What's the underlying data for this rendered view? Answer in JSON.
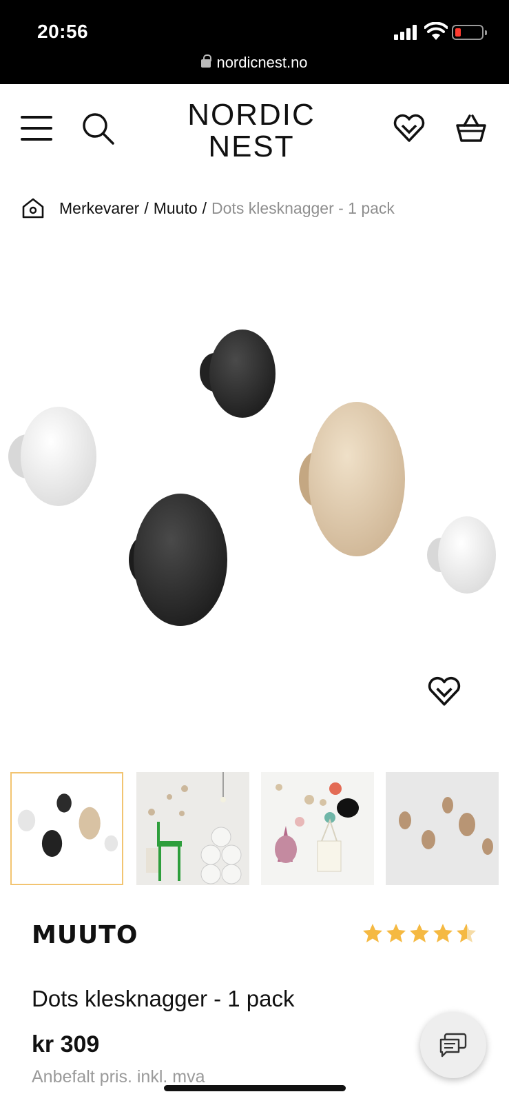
{
  "status_bar": {
    "time": "20:56",
    "url": "nordicnest.no"
  },
  "header": {
    "logo_line1": "NORDIC",
    "logo_line2": "NEST",
    "icons": [
      "menu-icon",
      "search-icon",
      "heart-icon",
      "basket-icon"
    ]
  },
  "breadcrumb": {
    "items": [
      "Merkevarer",
      "Muuto"
    ],
    "separator": "/",
    "current": "Dots klesknagger - 1 pack"
  },
  "product": {
    "brand": "MUUTO",
    "rating_stars": 4.5,
    "rating_max": 5,
    "title": "Dots klesknagger - 1 pack",
    "price": "kr 309",
    "price_note": "Anbefalt pris. inkl. mva"
  },
  "gallery": {
    "thumb_count": 4,
    "active_index": 0
  },
  "colors": {
    "status_bg": "#000000",
    "accent_border": "#f2c471",
    "star": "#f5b942",
    "muted_text": "#8e8e8e"
  }
}
